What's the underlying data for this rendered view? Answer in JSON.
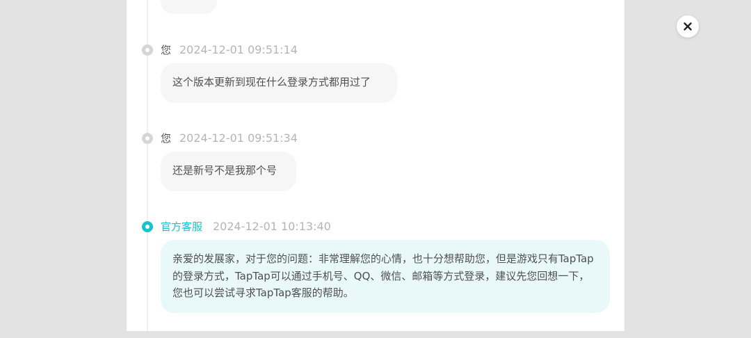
{
  "messages": [
    {
      "sender": "您",
      "timestamp": "2024-12-01 09:51:14",
      "text": "这个版本更新到现在什么登录方式都用过了",
      "role": "user"
    },
    {
      "sender": "您",
      "timestamp": "2024-12-01 09:51:34",
      "text": "还是新号不是我那个号",
      "role": "user"
    },
    {
      "sender": "官方客服",
      "timestamp": "2024-12-01 10:13:40",
      "text": "亲爱的发展家，对于您的问题：非常理解您的心情，也十分想帮助您，但是游戏只有TapTap的登录方式，TapTap可以通过手机号、QQ、微信、邮箱等方式登录，建议先您回想一下，您也可以尝试寻求TapTap客服的帮助。",
      "role": "official"
    }
  ],
  "controls": {
    "close_icon": "close-icon"
  },
  "colors": {
    "accent": "#15c5ce",
    "user_bubble": "#f6f6f6",
    "official_bubble": "#e9f8f9",
    "backdrop": "#e3e3e3"
  }
}
